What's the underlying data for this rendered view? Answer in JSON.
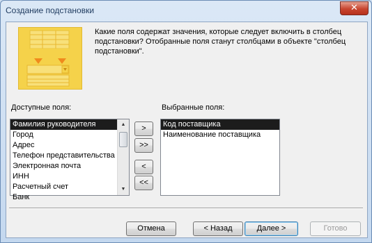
{
  "window": {
    "title": "Создание подстановки",
    "close_glyph": "✕"
  },
  "description": "Какие поля содержат значения, которые следует включить в столбец подстановки? Отобранные поля станут столбцами в объекте \"столбец подстановки\".",
  "available": {
    "label": "Доступные поля:",
    "items": [
      "Фамилия руководителя",
      "Город",
      "Адрес",
      "Телефон представительства",
      "Электронная почта",
      "ИНН",
      "Расчетный счет",
      "Банк"
    ],
    "selected_index": 0
  },
  "selected": {
    "label": "Выбранные поля:",
    "items": [
      "Код поставщика",
      "Наименование поставщика"
    ],
    "selected_index": 0
  },
  "move_buttons": {
    "add_one": ">",
    "add_all": ">>",
    "remove_one": "<",
    "remove_all": "<<"
  },
  "footer": {
    "cancel": "Отмена",
    "back": "< Назад",
    "next": "Далее >",
    "finish": "Готово"
  },
  "icons": {
    "scroll_up": "scroll-up-arrow-icon",
    "scroll_down": "scroll-down-arrow-icon",
    "illustration": "lookup-wizard-illustration"
  },
  "colors": {
    "illustration_bg": "#f5d24a",
    "arrow": "#f08a1c",
    "selection": "#1c1c1c",
    "default_button_border": "#3c7fb1"
  }
}
